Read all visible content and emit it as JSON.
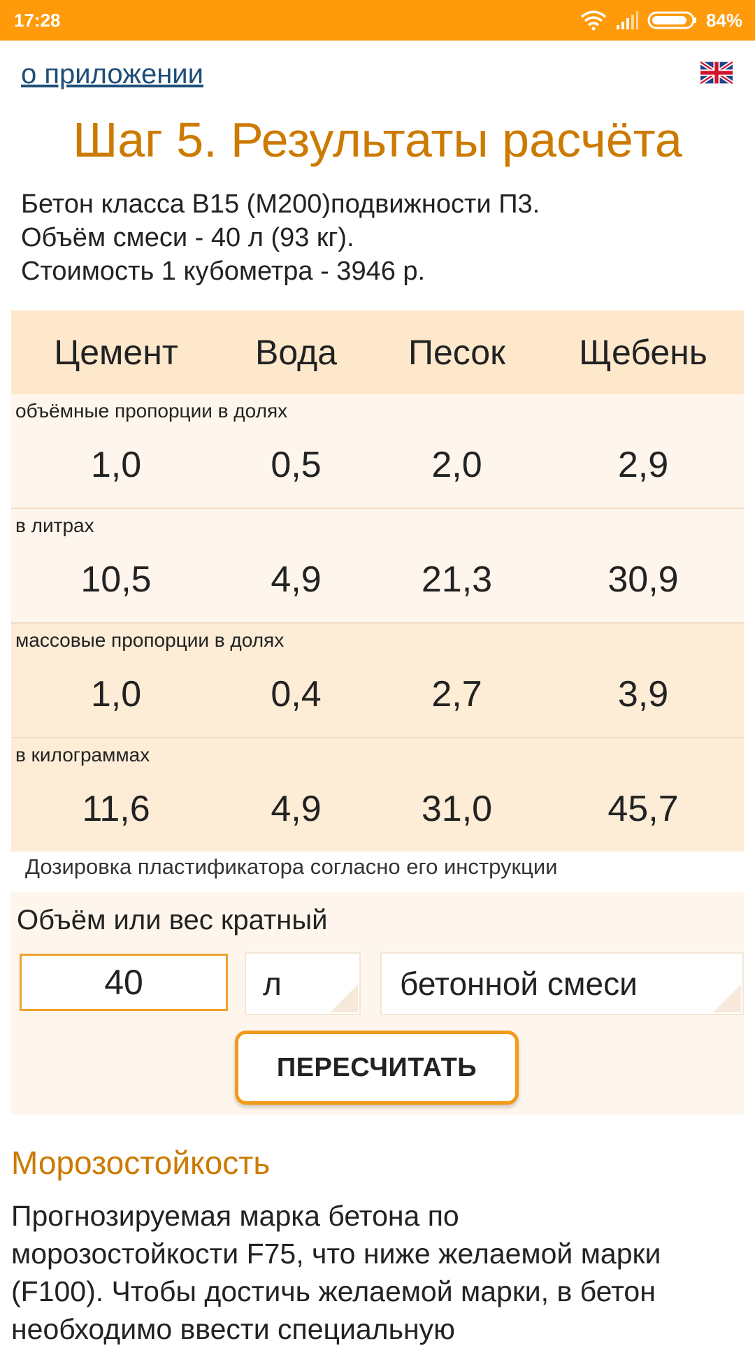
{
  "status_bar": {
    "time": "17:28",
    "battery": "84%",
    "icons": [
      "wifi-icon",
      "signal-icon",
      "battery-icon"
    ],
    "color": "#ff9a0a"
  },
  "header": {
    "about_link": "о приложении",
    "language_icon": "uk-flag-icon"
  },
  "title": "Шаг 5. Результаты расчёта",
  "summary": {
    "line1": "Бетон класса В15 (М200)подвижности П3.",
    "line2": "Объём смеси - 40 л (93 кг).",
    "line3": "Стоимость 1 кубометра - 3946 р."
  },
  "table": {
    "columns": [
      "Цемент",
      "Вода",
      "Песок",
      "Щебень"
    ],
    "sections": [
      {
        "caption": "объёмные пропорции в долях",
        "values": [
          "1,0",
          "0,5",
          "2,0",
          "2,9"
        ]
      },
      {
        "caption": "в литрах",
        "values": [
          "10,5",
          "4,9",
          "21,3",
          "30,9"
        ]
      },
      {
        "caption": "массовые пропорции в долях",
        "values": [
          "1,0",
          "0,4",
          "2,7",
          "3,9"
        ]
      },
      {
        "caption": "в килограммах",
        "values": [
          "11,6",
          "4,9",
          "31,0",
          "45,7"
        ]
      }
    ]
  },
  "plasticizer_note": "Дозировка пластификатора согласно его инструкции",
  "recalc": {
    "label": "Объём или вес кратный",
    "amount_value": "40",
    "unit": "л",
    "target": "бетонной смеси",
    "button_label": "ПЕРЕСЧИТАТЬ",
    "accent_color": "#f29a1a"
  },
  "frost": {
    "title": "Морозостойкость",
    "lines": [
      "Прогнозируемая марка бетона по",
      "морозостойкости F75, что ниже желаемой марки",
      "(F100). Чтобы достичь желаемой марки, в бетон",
      "необходимо ввести специальную"
    ],
    "title_color": "#cc7a00"
  }
}
